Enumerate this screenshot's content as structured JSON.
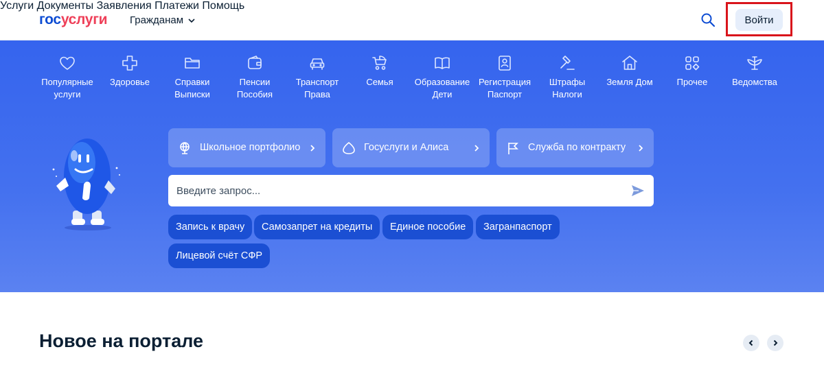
{
  "header": {
    "logo_part1": "гос",
    "logo_part2": "услуги",
    "audience": "Гражданам",
    "nav": [
      "Услуги",
      "Документы",
      "Заявления",
      "Платежи",
      "Помощь"
    ],
    "login": "Войти"
  },
  "categories": [
    {
      "icon": "heart-icon",
      "lines": [
        "Популярные",
        "услуги"
      ]
    },
    {
      "icon": "plus-cross-icon",
      "lines": [
        "Здоровье"
      ]
    },
    {
      "icon": "folder-icon",
      "lines": [
        "Справки",
        "Выписки"
      ]
    },
    {
      "icon": "wallet-icon",
      "lines": [
        "Пенсии",
        "Пособия"
      ]
    },
    {
      "icon": "car-icon",
      "lines": [
        "Транспорт",
        "Права"
      ]
    },
    {
      "icon": "stroller-icon",
      "lines": [
        "Семья"
      ]
    },
    {
      "icon": "book-icon",
      "lines": [
        "Образование",
        "Дети"
      ]
    },
    {
      "icon": "passport-icon",
      "lines": [
        "Регистрация",
        "Паспорт"
      ]
    },
    {
      "icon": "gavel-icon",
      "lines": [
        "Штрафы",
        "Налоги"
      ]
    },
    {
      "icon": "house-icon",
      "lines": [
        "Земля Дом"
      ]
    },
    {
      "icon": "grid-icon",
      "lines": [
        "Прочее"
      ]
    },
    {
      "icon": "emblem-icon",
      "lines": [
        "Ведомства"
      ]
    }
  ],
  "promo": [
    {
      "icon": "globe-icon",
      "label": "Школьное портфолио"
    },
    {
      "icon": "alice-icon",
      "label": "Госуслуги и Алиса"
    },
    {
      "icon": "flag-icon",
      "label": "Служба по контракту"
    }
  ],
  "search": {
    "placeholder": "Введите запрос..."
  },
  "quick_chips": [
    "Запись к врачу",
    "Самозапрет на кредиты",
    "Единое пособие",
    "Загранпаспорт",
    "Лицевой счёт СФР"
  ],
  "section": {
    "title": "Новое на портале"
  },
  "colors": {
    "brand_blue": "#0d4cd3",
    "brand_red": "#ee3f58",
    "hero_blue": "#3564ee",
    "chip_blue": "#1b4fd3",
    "highlight_red": "#d9141b"
  }
}
